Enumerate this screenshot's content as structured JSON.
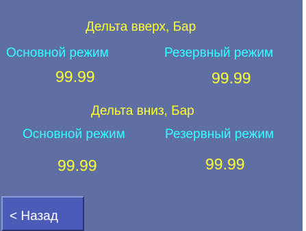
{
  "delta_up": {
    "title": "Дельта вверх, Бар",
    "primary_label": "Основной режим",
    "backup_label": "Резервный режим",
    "primary_value": "99.99",
    "backup_value": "99.99"
  },
  "delta_down": {
    "title": "Дельта вниз, Бар",
    "primary_label": "Основной режим",
    "backup_label": "Резервный режим",
    "primary_value": "99.99",
    "backup_value": "99.99"
  },
  "back_button": {
    "label": "< Назад"
  },
  "colors": {
    "background": "#5f6ea3",
    "title_text": "#ffff33",
    "mode_label_text": "#33ffff",
    "value_text": "#ffff33",
    "button_face": "#4b5cb8",
    "button_text": "#ffffff"
  }
}
